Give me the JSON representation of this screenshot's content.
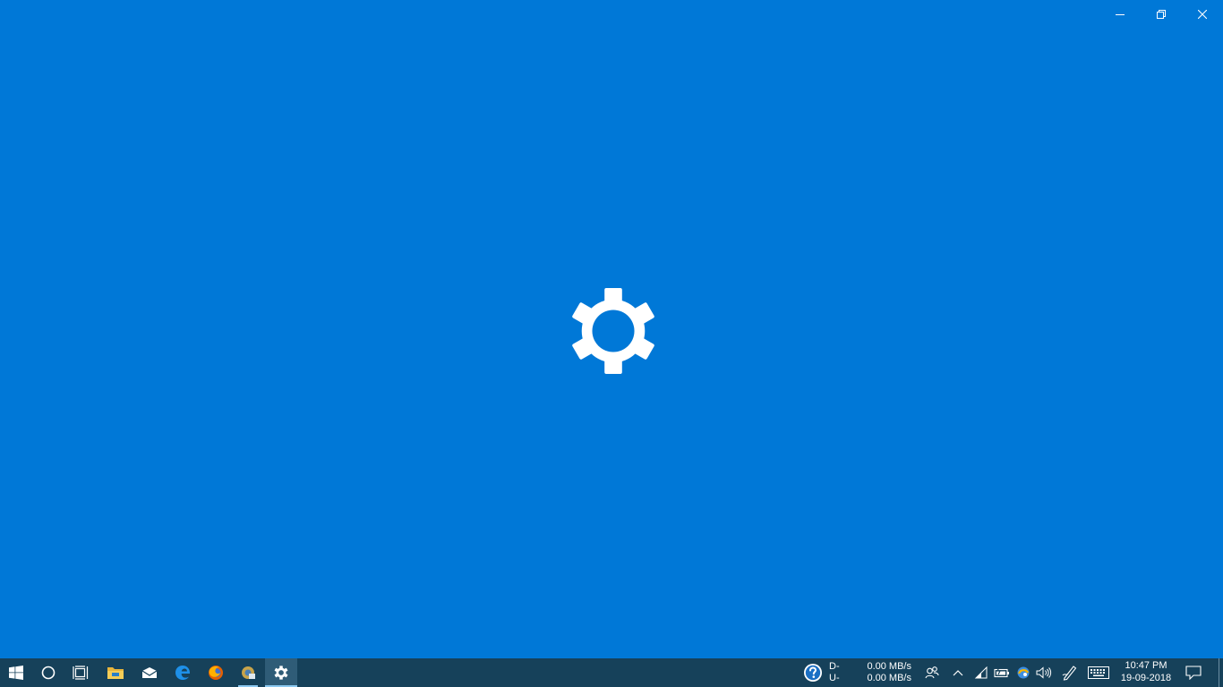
{
  "window": {
    "controls": {
      "minimize": "minimize-icon",
      "restore": "restore-icon",
      "close": "close-icon"
    },
    "splash_icon": "gear-icon",
    "background_color": "#0078d7"
  },
  "taskbar": {
    "background_color": "#16415a",
    "apps": [
      {
        "name": "start-button",
        "icon": "windows-logo-icon"
      },
      {
        "name": "cortana-button",
        "icon": "circle-icon"
      },
      {
        "name": "task-view-button",
        "icon": "task-view-icon"
      },
      {
        "name": "file-explorer",
        "icon": "folder-icon"
      },
      {
        "name": "mail",
        "icon": "mail-icon"
      },
      {
        "name": "edge",
        "icon": "edge-icon"
      },
      {
        "name": "firefox",
        "icon": "firefox-icon"
      },
      {
        "name": "app-running",
        "icon": "app-icon"
      },
      {
        "name": "settings",
        "icon": "gear-icon",
        "active": true
      }
    ],
    "network_monitor": {
      "download_label": "D-",
      "upload_label": "U-",
      "download_value": "0.00 MB/s",
      "upload_value": "0.00 MB/s"
    },
    "tray": {
      "help": "question-icon",
      "people": "people-icon",
      "chevron": "chevron-up-icon",
      "wifi": "wifi-icon",
      "battery": "battery-icon",
      "app": "tray-app-icon",
      "volume": "volume-icon",
      "pen": "pen-icon",
      "keyboard": "keyboard-icon",
      "notifications": "action-center-icon"
    },
    "clock": {
      "time": "10:47 PM",
      "date": "19-09-2018"
    }
  }
}
